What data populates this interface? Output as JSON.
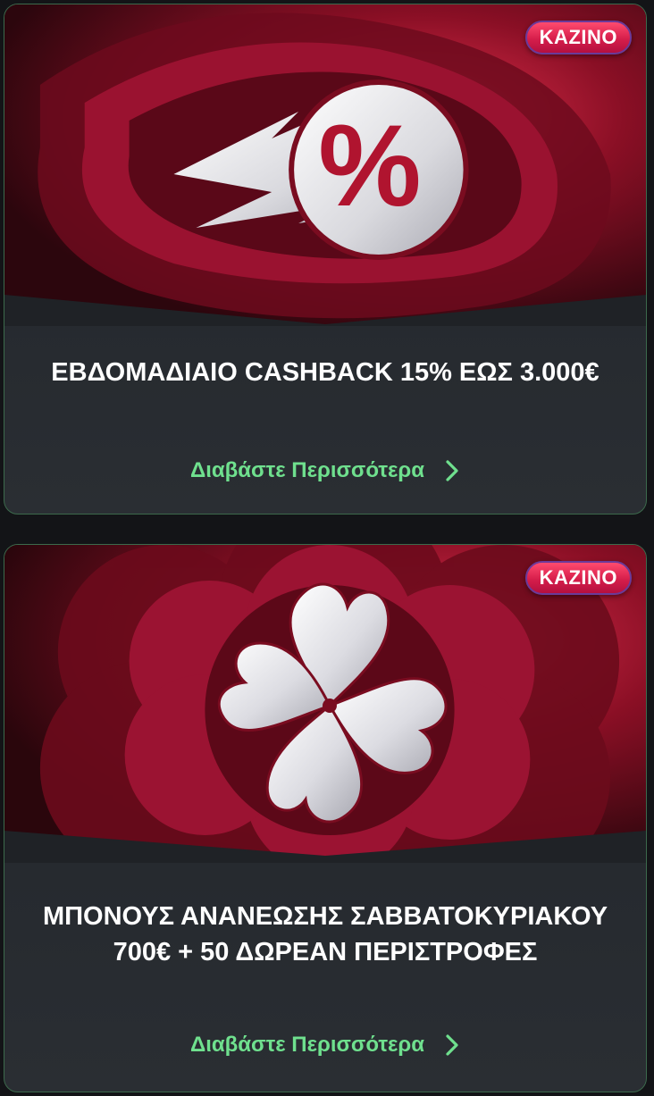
{
  "colors": {
    "page_background": "#131417",
    "card_border": "#3c6a4c",
    "link_green": "#6fe08e",
    "badge_pink": "#e0264f",
    "hero_red": "#a3132f"
  },
  "promotions": [
    {
      "badge": "KAZINO",
      "title": "ΕΒΔΟΜΑΔΙΑΙΟ CASHBACK 15% ΕΩΣ 3.000€",
      "link_label": "Διαβάστε Περισσότερα",
      "image_icon": "percent-comet-icon",
      "image_percent": "%"
    },
    {
      "badge": "KAZINO",
      "title": "ΜΠΟΝΟΥΣ ΑΝΑΝΕΩΣΗΣ ΣΑΒΒΑΤΟΚΥΡΙΑΚΟΥ 700€ + 50 ΔΩΡΕΑΝ ΠΕΡΙΣΤΡΟΦΕΣ",
      "link_label": "Διαβάστε Περισσότερα",
      "image_icon": "heart-clover-icon"
    }
  ],
  "icons": {
    "link_arrow": "chevron-right-icon"
  }
}
